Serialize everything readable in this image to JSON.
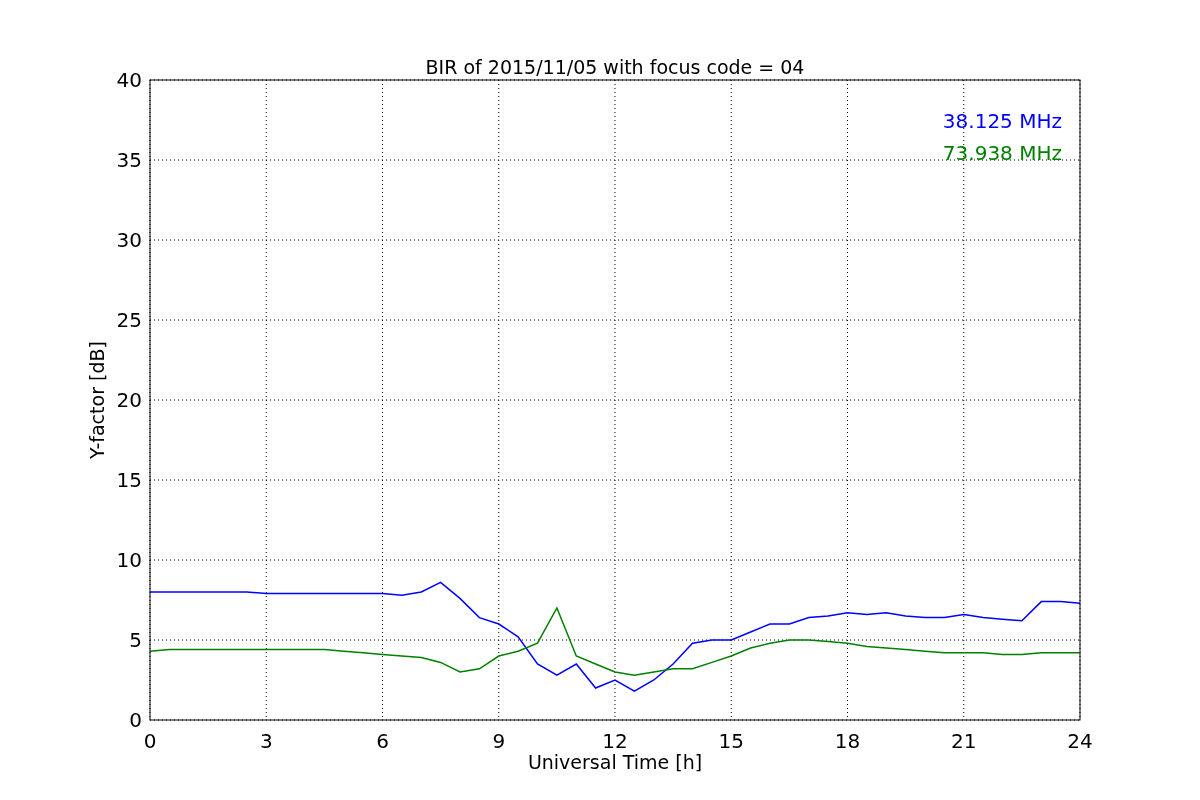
{
  "chart_data": {
    "type": "line",
    "title": "BIR of 2015/11/05 with focus code = 04",
    "xlabel": "Universal Time [h]",
    "ylabel": "Y-factor [dB]",
    "x": [
      0,
      0.5,
      1,
      1.5,
      2,
      2.5,
      3,
      3.5,
      4,
      4.5,
      5,
      5.5,
      6,
      6.5,
      7,
      7.5,
      8,
      8.5,
      9,
      9.5,
      10,
      10.5,
      11,
      11.5,
      12,
      12.5,
      13,
      13.5,
      14,
      14.5,
      15,
      15.5,
      16,
      16.5,
      17,
      17.5,
      18,
      18.5,
      19,
      19.5,
      20,
      20.5,
      21,
      21.5,
      22,
      22.5,
      23,
      23.5,
      24
    ],
    "series": [
      {
        "name": "38.125 MHz",
        "color": "#0000ff",
        "values": [
          8.0,
          8.0,
          8.0,
          8.0,
          8.0,
          8.0,
          7.9,
          7.9,
          7.9,
          7.9,
          7.9,
          7.9,
          7.9,
          7.8,
          8.0,
          8.6,
          7.6,
          6.4,
          6.0,
          5.2,
          3.5,
          2.8,
          3.5,
          2.0,
          2.5,
          1.8,
          2.5,
          3.5,
          4.8,
          5.0,
          5.0,
          5.5,
          6.0,
          6.0,
          6.4,
          6.5,
          6.7,
          6.6,
          6.7,
          6.5,
          6.4,
          6.4,
          6.6,
          6.4,
          6.3,
          6.2,
          7.4,
          7.4,
          7.3
        ]
      },
      {
        "name": "73.938 MHz",
        "color": "#008000",
        "values": [
          4.3,
          4.4,
          4.4,
          4.4,
          4.4,
          4.4,
          4.4,
          4.4,
          4.4,
          4.4,
          4.3,
          4.2,
          4.1,
          4.0,
          3.9,
          3.6,
          3.0,
          3.2,
          4.0,
          4.3,
          4.8,
          7.0,
          4.0,
          3.5,
          3.0,
          2.8,
          3.0,
          3.2,
          3.2,
          3.6,
          4.0,
          4.5,
          4.8,
          5.0,
          5.0,
          4.9,
          4.8,
          4.6,
          4.5,
          4.4,
          4.3,
          4.2,
          4.2,
          4.2,
          4.1,
          4.1,
          4.2,
          4.2,
          4.2
        ]
      }
    ],
    "xlim": [
      0,
      24
    ],
    "ylim": [
      0,
      40
    ],
    "xticks": [
      0,
      3,
      6,
      9,
      12,
      15,
      18,
      21,
      24
    ],
    "yticks": [
      0,
      5,
      10,
      15,
      20,
      25,
      30,
      35,
      40
    ],
    "grid": true
  }
}
